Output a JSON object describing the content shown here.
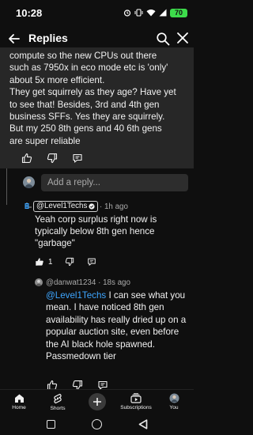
{
  "status_bar": {
    "time": "10:28",
    "battery": "70",
    "icons": [
      "alarm-icon",
      "vibrate-icon",
      "wifi-icon",
      "signal-icon",
      "battery-icon"
    ]
  },
  "header": {
    "title": "Replies",
    "back_icon": "arrow-left-icon",
    "search_icon": "search-icon",
    "close_icon": "close-icon"
  },
  "top_comment": {
    "lines": [
      "compute so the new CPUs out there",
      "such as 7950x in eco mode etc is 'only'",
      "about 5x more efficient.",
      "They get squirrely as they age? Have yet",
      "to see that! Besides, 3rd and 4th gen",
      "business SFFs. Yes they are squirrely.",
      "But my 250 8th gens and 40 6th gens",
      "are super reliable"
    ]
  },
  "reply_box": {
    "placeholder": "Add a reply..."
  },
  "replies": [
    {
      "author": "@Level1Techs",
      "verified": true,
      "time": "1h ago",
      "text": "Yeah corp surplus right now is typically below 8th gen hence \"garbage\"",
      "likes": "1"
    },
    {
      "author": "@danwat1234",
      "time": "18s ago",
      "mention": "@Level1Techs",
      "text": " I can see what you mean. I have noticed 8th gen availability has really dried up on a popular auction site, even before the AI black hole spawned. Passmedown tier"
    }
  ],
  "bottom_nav": {
    "items": [
      {
        "label": "Home",
        "icon": "home-icon"
      },
      {
        "label": "Shorts",
        "icon": "shorts-icon"
      },
      {
        "label": "",
        "icon": "create-icon"
      },
      {
        "label": "Subscriptions",
        "icon": "subscriptions-icon"
      },
      {
        "label": "You",
        "icon": "avatar-icon"
      }
    ]
  },
  "colors": {
    "background": "#0f0f0f",
    "card": "#272727",
    "mention": "#3ea6ff",
    "battery": "#3ddc4b"
  }
}
